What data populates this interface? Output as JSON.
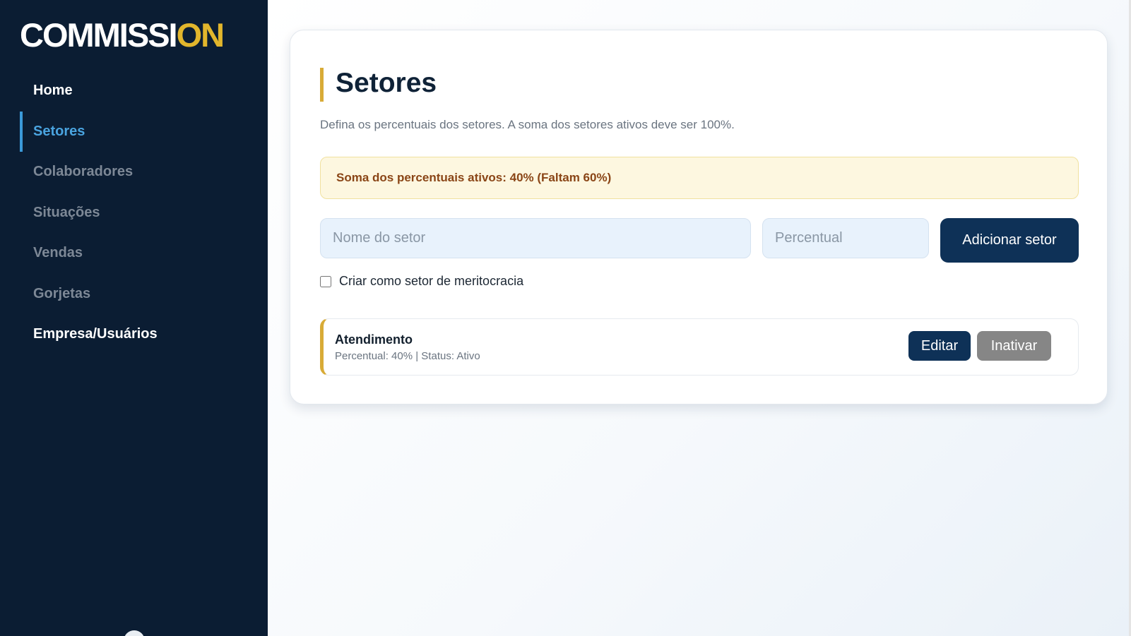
{
  "brand": {
    "logo_prefix": "COMMISSI",
    "logo_suffix": "ON",
    "accent_color": "#e2b62c"
  },
  "sidebar": {
    "items": [
      {
        "label": "Home",
        "state": "highlight"
      },
      {
        "label": "Setores",
        "state": "active"
      },
      {
        "label": "Colaboradores",
        "state": "normal"
      },
      {
        "label": "Situações",
        "state": "normal"
      },
      {
        "label": "Vendas",
        "state": "normal"
      },
      {
        "label": "Gorjetas",
        "state": "normal"
      },
      {
        "label": "Empresa/Usuários",
        "state": "highlight"
      }
    ]
  },
  "page": {
    "title": "Setores",
    "subtitle": "Defina os percentuais dos setores. A soma dos setores ativos deve ser 100%."
  },
  "alert": {
    "text": "Soma dos percentuais ativos: 40% (Faltam 60%)"
  },
  "form": {
    "name_placeholder": "Nome do setor",
    "name_value": "",
    "percent_placeholder": "Percentual",
    "percent_value": "",
    "add_label": "Adicionar setor",
    "meritocracy_label": "Criar como setor de meritocracia",
    "meritocracy_checked": false
  },
  "sectors": [
    {
      "name": "Atendimento",
      "meta": "Percentual: 40% | Status: Ativo",
      "edit_label": "Editar",
      "inactivate_label": "Inativar"
    }
  ],
  "colors": {
    "sidebar_bg": "#0b1d33",
    "primary_button": "#0e3157",
    "active_nav": "#4aa4e0",
    "alert_bg": "#fdf7e0",
    "alert_text": "#8a4516"
  }
}
